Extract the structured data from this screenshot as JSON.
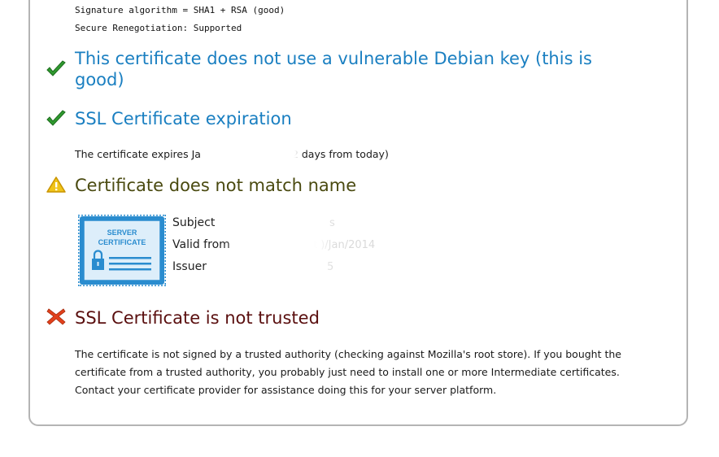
{
  "details": {
    "sig_line": "Signature algorithm = SHA1 + RSA (good)",
    "reneg_line": "Secure Renegotiation: Supported"
  },
  "debian": {
    "heading_line1": "This certificate does not use a vulnerable Debian key (this is",
    "heading_line2": "good)"
  },
  "expiration": {
    "heading": "SSL Certificate expiration",
    "text_prefix": "The certificate expires Ja",
    "text_suffix": "2 days from today)"
  },
  "name_match": {
    "heading": "Certificate does not match name"
  },
  "cert_badge": {
    "line1": "SERVER",
    "line2": "CERTIFICATE"
  },
  "cert_fields": {
    "subject_label": "Subject",
    "valid_label": "Valid from",
    "issuer_label": "Issuer",
    "valid_value_fragment": "t )/Jan/2014",
    "subject_value_fragment": "s",
    "issuer_value_fragment": "5"
  },
  "trust": {
    "heading": "SSL Certificate is not trusted",
    "para_line1": "The certificate is not signed by a trusted authority (checking against Mozilla's root store). If you bought the",
    "para_line2": "certificate from a trusted authority, you probably just need to install one or more Intermediate certificates.",
    "para_line3": "Contact your certificate provider for assistance doing this for your server platform."
  },
  "colors": {
    "ok": "#2f9a2f",
    "warn": "#f0c419",
    "fail": "#e2411c",
    "heading_blue": "#1a7fc1",
    "cert_blue": "#2a8ccf"
  },
  "icons": [
    "checkmark-icon",
    "checkmark-icon",
    "warning-icon",
    "error-x-icon"
  ]
}
